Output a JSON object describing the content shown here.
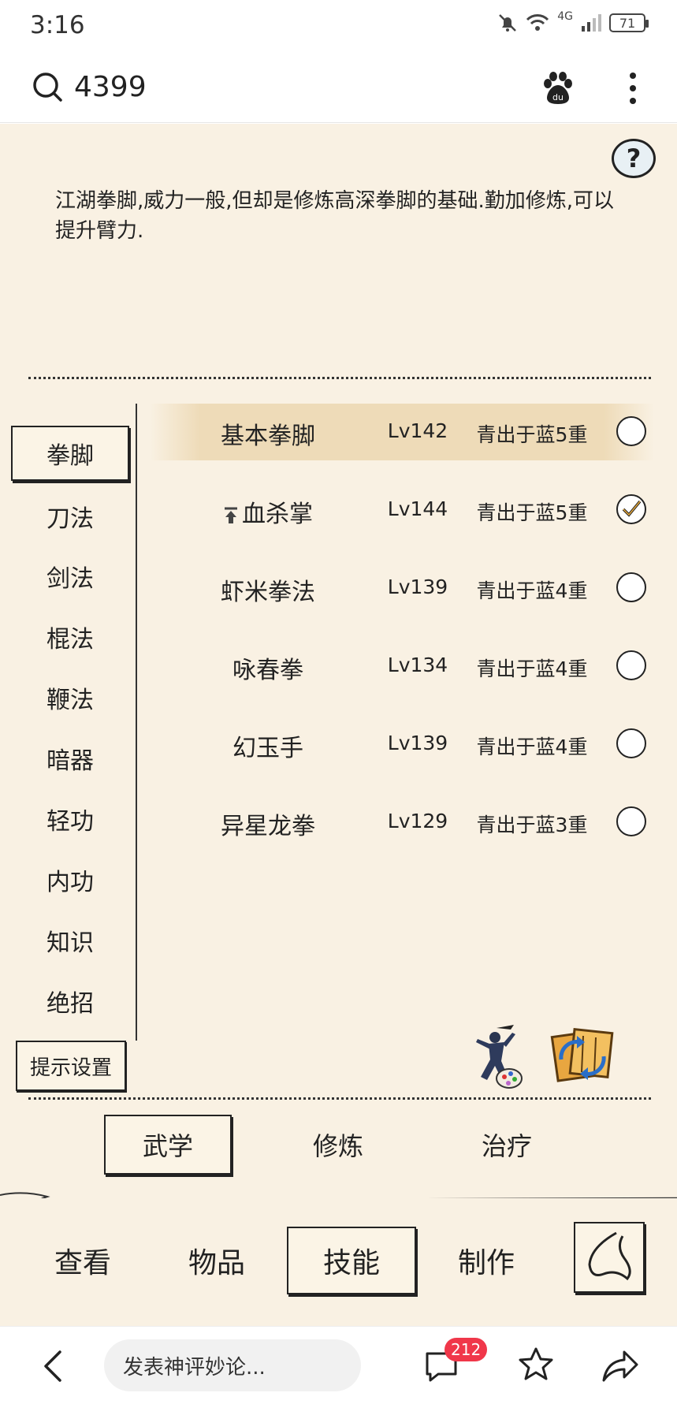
{
  "status_bar": {
    "time": "3:16",
    "network": "4G",
    "battery": "71"
  },
  "search": {
    "query": "4399"
  },
  "game": {
    "description": "江湖拳脚,威力一般,但却是修炼高深拳脚的基础.勤加修炼,可以提升臂力.",
    "help_label": "?",
    "categories": [
      "拳脚",
      "刀法",
      "剑法",
      "棍法",
      "鞭法",
      "暗器",
      "轻功",
      "内功",
      "知识",
      "绝招"
    ],
    "active_category": "拳脚",
    "tip_settings": "提示设置",
    "skills": [
      {
        "name": "基本拳脚",
        "level": "Lv142",
        "rank": "青出于蓝5重",
        "selected": false,
        "highlighted": true,
        "upgrade_arrow": false
      },
      {
        "name": "血杀掌",
        "level": "Lv144",
        "rank": "青出于蓝5重",
        "selected": true,
        "highlighted": false,
        "upgrade_arrow": true
      },
      {
        "name": "虾米拳法",
        "level": "Lv139",
        "rank": "青出于蓝4重",
        "selected": false,
        "highlighted": false,
        "upgrade_arrow": false
      },
      {
        "name": "咏春拳",
        "level": "Lv134",
        "rank": "青出于蓝4重",
        "selected": false,
        "highlighted": false,
        "upgrade_arrow": false
      },
      {
        "name": "幻玉手",
        "level": "Lv139",
        "rank": "青出于蓝4重",
        "selected": false,
        "highlighted": false,
        "upgrade_arrow": false
      },
      {
        "name": "异星龙拳",
        "level": "Lv129",
        "rank": "青出于蓝3重",
        "selected": false,
        "highlighted": false,
        "upgrade_arrow": false
      }
    ],
    "sub_tabs": [
      "武学",
      "修炼",
      "治疗"
    ],
    "active_sub_tab": "武学",
    "main_tabs": [
      "查看",
      "物品",
      "技能",
      "制作"
    ],
    "active_main_tab": "技能"
  },
  "browser_bar": {
    "comment_placeholder": "发表神评妙论...",
    "comment_count": "212"
  }
}
